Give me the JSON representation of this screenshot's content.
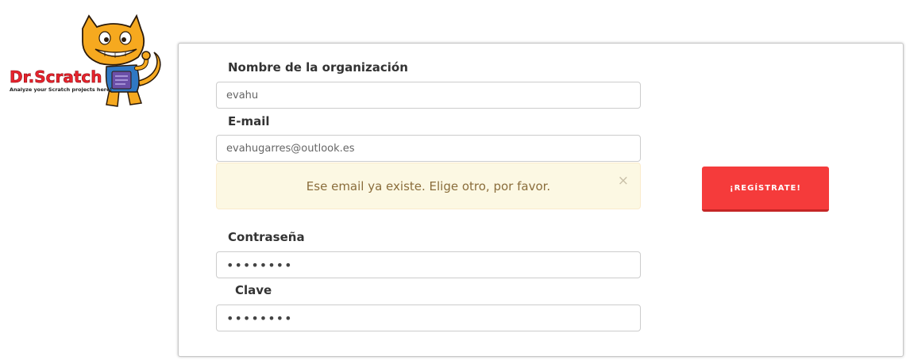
{
  "logo": {
    "brand": "Dr.Scratch",
    "tagline": "Analyze your Scratch projects here!"
  },
  "form": {
    "org_label": "Nombre de la organización",
    "org_value": "evahu",
    "email_label": "E-mail",
    "email_value": "evahugarres@outlook.es",
    "alert_message": "Ese email ya existe. Elige otro, por favor.",
    "alert_close": "×",
    "password_label": "Contraseña",
    "password_value": "••••••••",
    "confirm_label": "Clave",
    "confirm_value": "••••••••",
    "register_label": "¡REGÍSTRATE!"
  },
  "colors": {
    "register_button": "#f53b3b",
    "alert_background": "#fcf8e3",
    "alert_text": "#8a6d3b",
    "logo_red": "#e8232d",
    "cat_orange": "#f6a91f"
  }
}
